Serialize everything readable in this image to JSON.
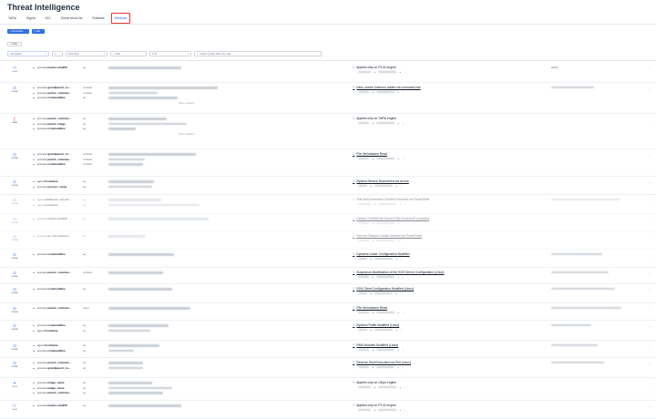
{
  "title": "Threat Intelligence",
  "tabs": [
    {
      "label": "YARA",
      "active": false
    },
    {
      "label": "Sigma",
      "active": false
    },
    {
      "label": "IOC",
      "active": false
    },
    {
      "label": "Online block list",
      "active": false
    },
    {
      "label": "Rulesets",
      "active": false
    },
    {
      "label": "Windows",
      "active": true
    }
  ],
  "toolbar": {
    "add_label": "Add window",
    "edit_label": "Edit",
    "filter_label": "Filter"
  },
  "filter_bar": {
    "field_value": "Last update",
    "type_placeholder": "Field name",
    "op_placeholder": "Filter",
    "value_placeholder": "All",
    "search_placeholder": "Search by field, value, rule, tags..."
  },
  "colors": {
    "accent": "#2f6fdf",
    "highlight_border": "#e53935",
    "yara": "#e11d48"
  },
  "rows": [
    {
      "source": "FS AI",
      "icon": "fs-icon",
      "conditions": [
        {
          "field_prefix": "process.",
          "field_bold": "hashes.sha256",
          "op": "eq"
        }
      ],
      "rule": "Applies only on FS AI engine",
      "underline": false,
      "desc": "Amho"
    },
    {
      "source": "SIGMA",
      "icon": "sigma-icon",
      "conditions": [
        {
          "field_prefix": "process.",
          "field_bold": "grandparent_co...",
          "op": "contains"
        },
        {
          "field_prefix": "process.",
          "field_bold": "parent_comman...",
          "op": "contains"
        },
        {
          "field_prefix": "process.",
          "field_bold": "commandline",
          "op": "eq"
        }
      ],
      "more": "Show conditions",
      "rule": "New Launch Daemon added via command line",
      "underline": true,
      "desc": ""
    },
    {
      "source": "YARA",
      "icon": "yara-icon",
      "conditions": [
        {
          "field_prefix": "process.",
          "field_bold": "parent_comman...",
          "op": "eq"
        },
        {
          "field_prefix": "process.",
          "field_bold": "parent_image",
          "op": "eq"
        },
        {
          "field_prefix": "process.",
          "field_bold": "commandline",
          "op": "eq"
        }
      ],
      "more": "Show conditions",
      "rule": "Applies only on YARA engine",
      "underline": false,
      "desc": ""
    },
    {
      "source": "SIGMA",
      "icon": "sigma-icon",
      "conditions": [
        {
          "field_prefix": "process.",
          "field_bold": "grandparent_co...",
          "op": "contains"
        },
        {
          "field_prefix": "process.",
          "field_bold": "parent_comman...",
          "op": "contains"
        },
        {
          "field_prefix": "process.",
          "field_bold": "commandline",
          "op": "contains"
        }
      ],
      "rule": "File /etc/shadow Read",
      "underline": true,
      "desc": ""
    },
    {
      "source": "SIGMA",
      "icon": "sigma-icon",
      "conditions": [
        {
          "field_prefix": "agent.",
          "field_bold": "hostname",
          "op": "eq"
        },
        {
          "field_prefix": "process.",
          "field_bold": "process_name",
          "op": "eq"
        }
      ],
      "rule": "System Service Discovered via ss.exe",
      "underline": true,
      "desc": ""
    },
    {
      "source": "SIGMA",
      "icon": "sigma-icon",
      "faded": true,
      "conditions": [
        {
          "field_prefix": "agent.",
          "field_bold": "additional_info.ad...",
          "op": "eq"
        },
        {
          "field_prefix": "agent.",
          "field_bold": "hostname",
          "op": "eq"
        }
      ],
      "rule": "Test-NetConnection Cmdlet Executed via PowerShell",
      "underline": false,
      "desc": ""
    },
    {
      "source": "SIGMA",
      "icon": "sigma-icon",
      "faded": true,
      "conditions": [
        {
          "field_prefix": "process.",
          "field_bold": "hashes.sha256",
          "op": "eq"
        }
      ],
      "rule": "Default Cmdlt/Write Named Pipe Enabled/Connected",
      "underline": true,
      "desc": ""
    },
    {
      "source": "SIGMA",
      "icon": "sigma-icon",
      "faded": true,
      "conditions": [
        {
          "field_prefix": "process.",
          "field_bold": "pe_info.internal...",
          "op": "eq"
        }
      ],
      "rule": "Volume Shadow Create Deleted via PowerShell",
      "underline": true,
      "desc": ""
    },
    {
      "source": "SIGMA",
      "icon": "sigma-icon",
      "conditions": [
        {
          "field_prefix": "process.",
          "field_bold": "commandline",
          "op": "eq"
        }
      ],
      "rule": "Dynamic Linker Configuration Modified",
      "underline": true,
      "desc": ""
    },
    {
      "source": "SIGMA",
      "icon": "sigma-icon",
      "conditions": [
        {
          "field_prefix": "process.",
          "field_bold": "parent_comman...",
          "op": "contains"
        }
      ],
      "rule": "Suspicious Modification of the SSH Server Configuration (Linux)",
      "underline": true,
      "desc": ""
    },
    {
      "source": "SIGMA",
      "icon": "sigma-icon",
      "conditions": [
        {
          "field_prefix": "process.",
          "field_bold": "commandline",
          "op": "eq"
        }
      ],
      "rule": "SSH Client Configuration Modified (Linux)",
      "underline": true,
      "desc": ""
    },
    {
      "source": "SIGMA",
      "icon": "sigma-icon",
      "conditions": [
        {
          "field_prefix": "process.",
          "field_bold": "parent_comman...",
          "op": "regex"
        }
      ],
      "rule": "File /etc/shadow Read",
      "underline": true,
      "desc": ""
    },
    {
      "source": "SIGMA",
      "icon": "sigma-icon",
      "conditions": [
        {
          "field_prefix": "process.",
          "field_bold": "commandline",
          "op": "eq"
        },
        {
          "field_prefix": "agent.",
          "field_bold": "hostname",
          "op": "eq"
        }
      ],
      "rule": "System Profile Modified (Linux)",
      "underline": true,
      "desc": ""
    },
    {
      "source": "SIGMA",
      "icon": "sigma-icon",
      "conditions": [
        {
          "field_prefix": "agent.",
          "field_bold": "hostname",
          "op": "eq"
        },
        {
          "field_prefix": "process.",
          "field_bold": "commandline",
          "op": "eq"
        }
      ],
      "rule": "PAM Modules Modified (Linux)",
      "underline": true,
      "desc": ""
    },
    {
      "source": "SIGMA",
      "icon": "sigma-icon",
      "conditions": [
        {
          "field_prefix": "process.",
          "field_bold": "parent_comman...",
          "op": "eq"
        },
        {
          "field_prefix": "process.",
          "field_bold": "grandparent_co...",
          "op": "eq"
        }
      ],
      "rule": "Reverse Shell Executed via Perl (Linux)",
      "underline": true,
      "desc": ""
    },
    {
      "source": "CLIPS",
      "icon": "clips-icon",
      "conditions": [
        {
          "field_prefix": "process.",
          "field_bold": "image_name",
          "op": "eq"
        },
        {
          "field_prefix": "process.",
          "field_bold": "image_name",
          "op": "eq"
        },
        {
          "field_prefix": "process.",
          "field_bold": "parent_comman...",
          "op": "eq"
        }
      ],
      "rule": "Applies only on Clrips engine",
      "underline": false,
      "desc": ""
    },
    {
      "source": "FS AI",
      "icon": "fs-icon",
      "conditions": [
        {
          "field_prefix": "process.",
          "field_bold": "hashes.sha256",
          "op": "eq"
        }
      ],
      "rule": "Applies only on FS AI engine",
      "underline": false,
      "desc": ""
    }
  ]
}
